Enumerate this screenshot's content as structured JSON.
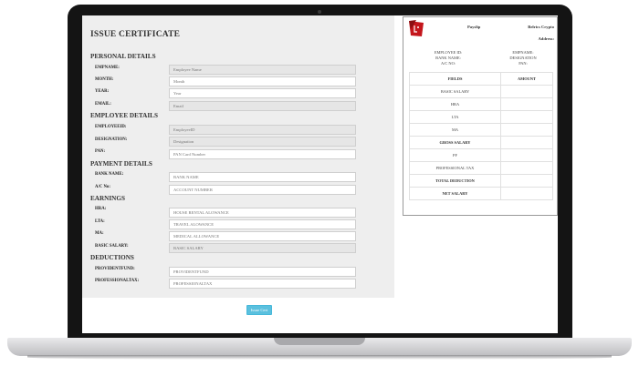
{
  "form": {
    "title": "ISSUE CERTIFICATE",
    "sections": {
      "personal": "PERSONAL DETAILS",
      "employee": "EMPLOYEE DETAILS",
      "payment": "PAYMENT DETAILS",
      "earnings": "EARNINGS",
      "deductions": "DEDUCTIONS"
    },
    "fields": {
      "empname": {
        "label": "EMPNAME:",
        "placeholder": "Employee Name"
      },
      "month": {
        "label": "MONTH:",
        "placeholder": "Month"
      },
      "year": {
        "label": "YEAR:",
        "placeholder": "Year"
      },
      "email": {
        "label": "EMAIL:",
        "placeholder": "Email"
      },
      "employeeid": {
        "label": "EMPLOYEEID:",
        "placeholder": "EmployeeID"
      },
      "designation": {
        "label": "DESIGNATION:",
        "placeholder": "Designation"
      },
      "pan": {
        "label": "PAN:",
        "placeholder": "PAN Card Number"
      },
      "bankname": {
        "label": "BANK NAME:",
        "placeholder": "BANK NAME"
      },
      "acno": {
        "label": "A/C No:",
        "placeholder": "ACCOUNT NUMBER"
      },
      "hra": {
        "label": "HRA:",
        "placeholder": "HOUSE RENTAL ALOWANCE"
      },
      "lta": {
        "label": "LTA:",
        "placeholder": "TRAVEL ALOWANCE"
      },
      "ma": {
        "label": "MA:",
        "placeholder": "MEDICAL ALLOWANCE"
      },
      "basicsalary": {
        "label": "BASIC SALARY:",
        "placeholder": "BASIC SALARY"
      },
      "providentfund": {
        "label": "PROVIDENTFUND:",
        "placeholder": "PROVIDENTFUND"
      },
      "professionaltax": {
        "label": "PROFESSIONALTAX:",
        "placeholder": "PROFESSIONALTAX"
      }
    },
    "issue_button": "Issue Cert"
  },
  "payslip": {
    "logo_icon": "brand-logo-icon",
    "title": "Payslip",
    "company": "Belrics Crypto",
    "address_label": "Address:",
    "meta_left": [
      "EMPLOYEE ID:",
      "BANK NAME:",
      "A/C NO:"
    ],
    "meta_right": [
      "EMPNAME:",
      "DESIGNATION",
      "PAN:"
    ],
    "table_headers": [
      "FIELDS",
      "AMOUNT"
    ],
    "rows": [
      {
        "field": "BASIC SALARY",
        "amount": ""
      },
      {
        "field": "HRA",
        "amount": ""
      },
      {
        "field": "LTA",
        "amount": ""
      },
      {
        "field": "MA",
        "amount": ""
      },
      {
        "field": "GROSS SALARY",
        "amount": ""
      },
      {
        "field": "PF",
        "amount": ""
      },
      {
        "field": "PROFESSIONAL TAX",
        "amount": ""
      },
      {
        "field": "TOTAL DEDUCTION",
        "amount": ""
      },
      {
        "field": "NET SALARY",
        "amount": ""
      }
    ]
  },
  "colors": {
    "accent": "#5bc0de",
    "logo_red": "#c4161c",
    "panel_bg": "#eeeeee"
  }
}
